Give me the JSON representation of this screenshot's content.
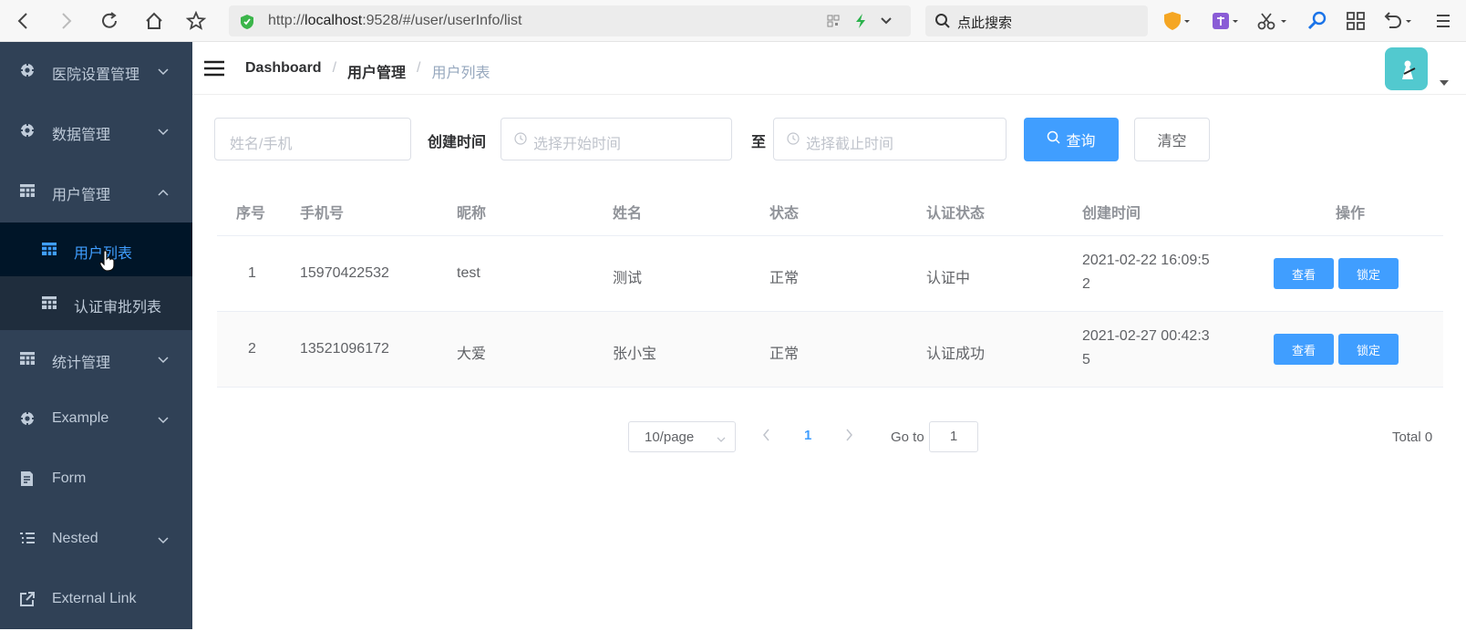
{
  "browser": {
    "url_prefix": "http://",
    "url_host": "localhost",
    "url_rest": ":9528/#/user/userInfo/list",
    "search_placeholder": "点此搜索"
  },
  "sidebar": {
    "items": [
      {
        "label": "医院设置管理",
        "icon": "gear-icon",
        "expandable": true
      },
      {
        "label": "数据管理",
        "icon": "gear-icon",
        "expandable": true
      },
      {
        "label": "用户管理",
        "icon": "table-icon",
        "expandable": true,
        "expanded": true
      },
      {
        "label": "统计管理",
        "icon": "table-icon",
        "expandable": true
      },
      {
        "label": "Example",
        "icon": "gear-icon",
        "expandable": true
      },
      {
        "label": "Form",
        "icon": "form-icon",
        "expandable": false
      },
      {
        "label": "Nested",
        "icon": "nested-icon",
        "expandable": true
      },
      {
        "label": "External Link",
        "icon": "link-icon",
        "expandable": false
      }
    ],
    "subitems": [
      {
        "label": "用户列表",
        "active": true
      },
      {
        "label": "认证审批列表",
        "active": false
      }
    ]
  },
  "breadcrumb": [
    "Dashboard",
    "用户管理",
    "用户列表"
  ],
  "filter": {
    "name_placeholder": "姓名/手机",
    "created_label": "创建时间",
    "start_placeholder": "选择开始时间",
    "to_label": "至",
    "end_placeholder": "选择截止时间",
    "search_button": "查询",
    "clear_button": "清空"
  },
  "table": {
    "headers": [
      "序号",
      "手机号",
      "昵称",
      "姓名",
      "状态",
      "认证状态",
      "创建时间",
      "操作"
    ],
    "rows": [
      {
        "index": "1",
        "phone": "15970422532",
        "nickname": "test",
        "name": "测试",
        "status": "正常",
        "auth": "认证中",
        "time1": "2021-02-22 16:09:5",
        "time2": "2",
        "view": "查看",
        "lock": "锁定"
      },
      {
        "index": "2",
        "phone": "13521096172",
        "nickname": "大爱",
        "name": "张小宝",
        "status": "正常",
        "auth": "认证成功",
        "time1": "2021-02-27 00:42:3",
        "time2": "5",
        "view": "查看",
        "lock": "锁定"
      }
    ]
  },
  "pagination": {
    "page_size": "10/page",
    "current_page": "1",
    "goto_label": "Go to",
    "goto_value": "1",
    "total": "Total 0"
  },
  "colors": {
    "sidebar_bg": "#304156",
    "accent": "#409eff"
  }
}
